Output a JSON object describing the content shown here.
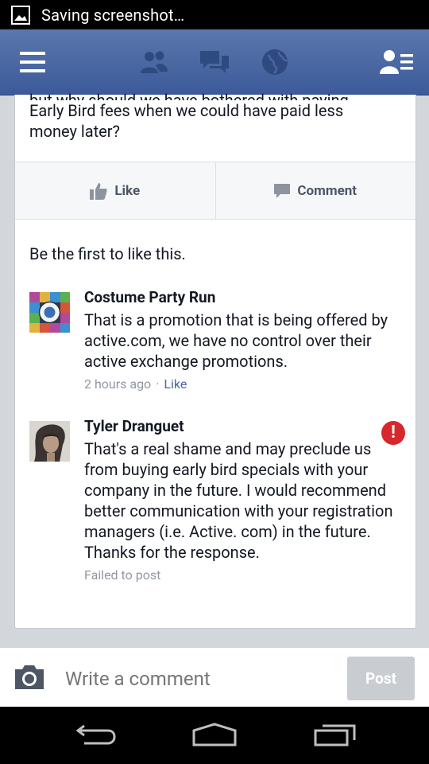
{
  "statusbar": {
    "text": "Saving screenshot…",
    "icon": "image-icon"
  },
  "appbar": {
    "icons": [
      "menu-icon",
      "friend-requests-icon",
      "messages-icon",
      "notifications-globe-icon",
      "friends-list-icon"
    ]
  },
  "post": {
    "partial_first_line": "but why should we have bothered with paying",
    "text_lines": [
      "Early Bird fees when we could have paid less",
      "money later?"
    ]
  },
  "actions": {
    "like": "Like",
    "comment": "Comment"
  },
  "likes_line": "Be the first to like this.",
  "comments": [
    {
      "author": "Costume Party Run",
      "text": "That is a promotion that is being offered by active.com, we have no control over their active exchange promotions.",
      "time": "2 hours ago",
      "dot": "·",
      "like": "Like"
    },
    {
      "author": "Tyler Dranguet",
      "text": "That's a real shame and may preclude us from buying early bird specials with your company in the future. I would recommend better communication with your registration managers (i.e. Active. com)  in the future. Thanks for the response.",
      "status": "Failed to post",
      "error_symbol": "!"
    }
  ],
  "composer": {
    "placeholder": "Write a comment",
    "post_label": "Post"
  },
  "colors": {
    "brand": "#3b5998",
    "error": "#d8262d",
    "link": "#4b67a1"
  }
}
